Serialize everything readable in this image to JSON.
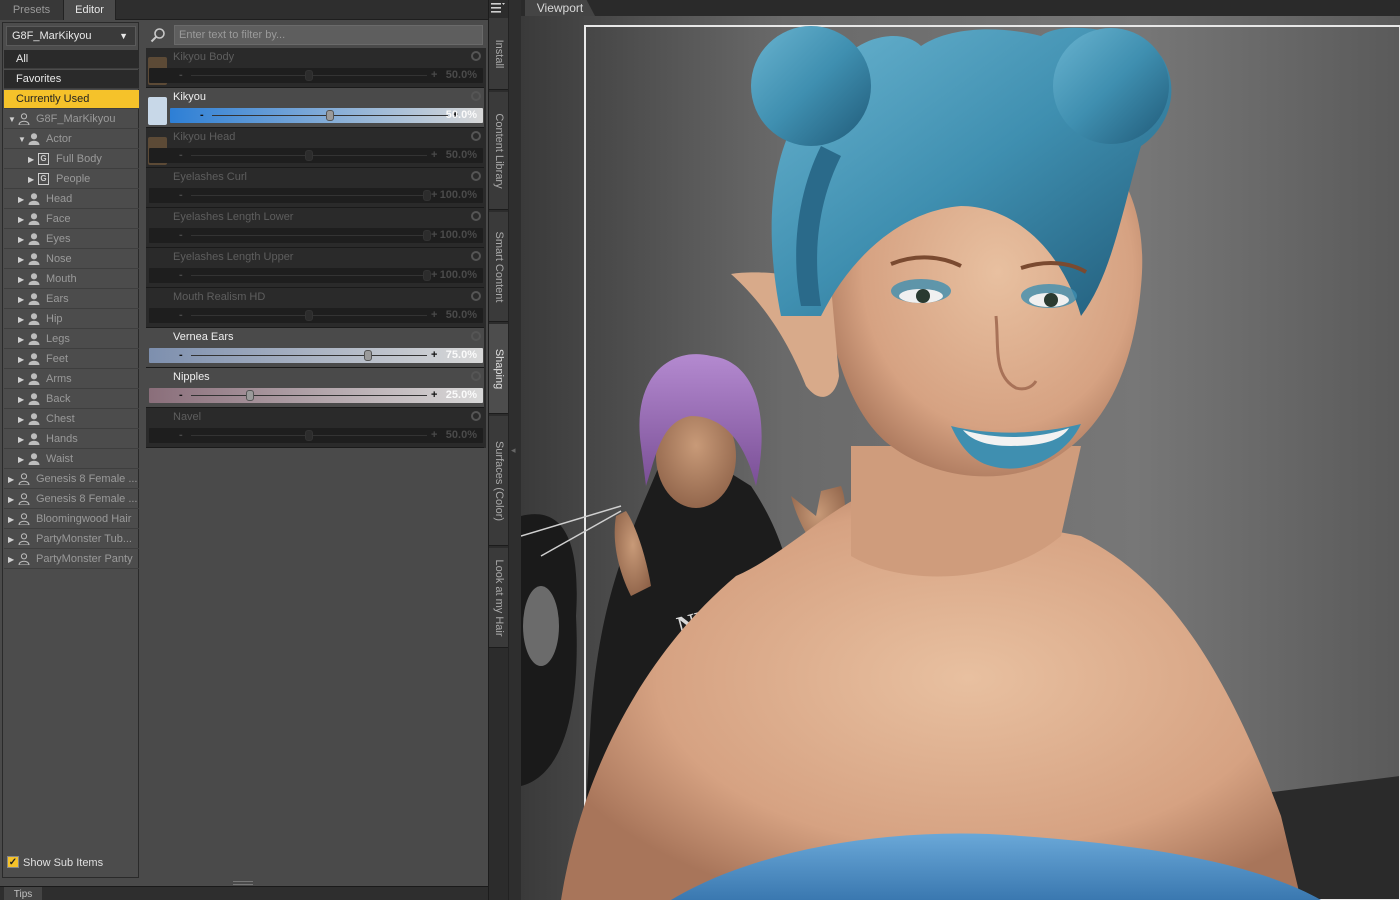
{
  "tabs": {
    "presets": "Presets",
    "editor": "Editor",
    "tips": "Tips"
  },
  "tree": {
    "figure_select": "G8F_MarKikyou",
    "flat_items": [
      "All",
      "Favorites",
      "Currently Used"
    ],
    "nodes": [
      {
        "label": "G8F_MarKikyou",
        "depth": 0,
        "icon": "figure-icon",
        "expanded": true
      },
      {
        "label": "Actor",
        "depth": 1,
        "icon": "figure-icon",
        "expanded": true
      },
      {
        "label": "Full Body",
        "depth": 2,
        "icon": "group-icon"
      },
      {
        "label": "People",
        "depth": 2,
        "icon": "group-icon"
      },
      {
        "label": "Head",
        "depth": 1,
        "icon": "figure-icon"
      },
      {
        "label": "Face",
        "depth": 1,
        "icon": "figure-icon"
      },
      {
        "label": "Eyes",
        "depth": 1,
        "icon": "figure-icon"
      },
      {
        "label": "Nose",
        "depth": 1,
        "icon": "figure-icon"
      },
      {
        "label": "Mouth",
        "depth": 1,
        "icon": "figure-icon"
      },
      {
        "label": "Ears",
        "depth": 1,
        "icon": "figure-icon"
      },
      {
        "label": "Hip",
        "depth": 1,
        "icon": "figure-icon"
      },
      {
        "label": "Legs",
        "depth": 1,
        "icon": "figure-icon"
      },
      {
        "label": "Feet",
        "depth": 1,
        "icon": "figure-icon"
      },
      {
        "label": "Arms",
        "depth": 1,
        "icon": "figure-icon"
      },
      {
        "label": "Back",
        "depth": 1,
        "icon": "figure-icon"
      },
      {
        "label": "Chest",
        "depth": 1,
        "icon": "figure-icon"
      },
      {
        "label": "Hands",
        "depth": 1,
        "icon": "figure-icon"
      },
      {
        "label": "Waist",
        "depth": 1,
        "icon": "figure-icon"
      },
      {
        "label": "Genesis 8 Female ...",
        "depth": 0,
        "icon": "figure-icon"
      },
      {
        "label": "Genesis 8 Female ...",
        "depth": 0,
        "icon": "figure-icon"
      },
      {
        "label": "Bloomingwood Hair",
        "depth": 0,
        "icon": "figure-icon"
      },
      {
        "label": "PartyMonster Tub...",
        "depth": 0,
        "icon": "figure-icon"
      },
      {
        "label": "PartyMonster Panty",
        "depth": 0,
        "icon": "figure-icon"
      }
    ],
    "show_sub_items": "Show Sub Items"
  },
  "filter": {
    "placeholder": "Enter text to filter by..."
  },
  "sliders": [
    {
      "name": "Kikyou Body",
      "value": "50.0%",
      "level": 0.5,
      "active": false,
      "thumb": true,
      "color": "#1c2b3a"
    },
    {
      "name": "Kikyou",
      "value": "50.0%",
      "level": 0.5,
      "active": true,
      "thumb": true,
      "color": "#2d7fd6"
    },
    {
      "name": "Kikyou Head",
      "value": "50.0%",
      "level": 0.5,
      "active": false,
      "thumb": true,
      "color": "#1c2b3a"
    },
    {
      "name": "Eyelashes Curl",
      "value": "100.0%",
      "level": 1.0,
      "active": false,
      "thumb": false,
      "color": "#1e1e1e"
    },
    {
      "name": "Eyelashes Length Lower",
      "value": "100.0%",
      "level": 1.0,
      "active": false,
      "thumb": false,
      "color": "#1e1e1e"
    },
    {
      "name": "Eyelashes Length Upper",
      "value": "100.0%",
      "level": 1.0,
      "active": false,
      "thumb": false,
      "color": "#1e1e1e"
    },
    {
      "name": "Mouth Realism HD",
      "value": "50.0%",
      "level": 0.5,
      "active": false,
      "thumb": false,
      "color": "#1e1e1e"
    },
    {
      "name": "Vernea Ears",
      "value": "75.0%",
      "level": 0.75,
      "active": true,
      "thumb": false,
      "color": "#7d8fae"
    },
    {
      "name": "Nipples",
      "value": "25.0%",
      "level": 0.25,
      "active": true,
      "thumb": false,
      "color": "#8a6e7a"
    },
    {
      "name": "Navel",
      "value": "50.0%",
      "level": 0.5,
      "active": false,
      "thumb": false,
      "color": "#1e1e1e"
    }
  ],
  "side_tabs": [
    "Install",
    "Content Library",
    "Smart Content",
    "Shaping",
    "Surfaces (Color)",
    "Look at my Hair"
  ],
  "viewport": {
    "tab": "Viewport"
  },
  "colors": {
    "accent": "#f5c22a",
    "hair_blue": "#3f8fb0",
    "hair_purple": "#9a6fb5"
  }
}
